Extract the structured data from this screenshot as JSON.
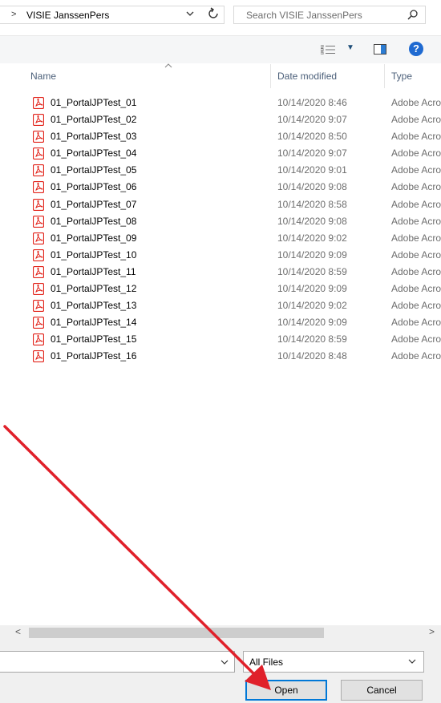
{
  "address_bar": {
    "chevron": ">",
    "path": "VISIE JanssenPers",
    "dropdown_icon": "chevron-down-icon",
    "refresh_icon": "refresh-icon"
  },
  "search": {
    "placeholder": "Search VISIE JanssenPers",
    "icon": "search-icon"
  },
  "toolbar": {
    "view_icon": "view-options-icon",
    "preview_pane_icon": "preview-pane-icon",
    "help_label": "?"
  },
  "columns": {
    "name": "Name",
    "date_modified": "Date modified",
    "type": "Type"
  },
  "files": [
    {
      "name": "01_PortalJPTest_01",
      "date": "10/14/2020 8:46",
      "type": "Adobe Acrobat Document"
    },
    {
      "name": "01_PortalJPTest_02",
      "date": "10/14/2020 9:07",
      "type": "Adobe Acrobat Document"
    },
    {
      "name": "01_PortalJPTest_03",
      "date": "10/14/2020 8:50",
      "type": "Adobe Acrobat Document"
    },
    {
      "name": "01_PortalJPTest_04",
      "date": "10/14/2020 9:07",
      "type": "Adobe Acrobat Document"
    },
    {
      "name": "01_PortalJPTest_05",
      "date": "10/14/2020 9:01",
      "type": "Adobe Acrobat Document"
    },
    {
      "name": "01_PortalJPTest_06",
      "date": "10/14/2020 9:08",
      "type": "Adobe Acrobat Document"
    },
    {
      "name": "01_PortalJPTest_07",
      "date": "10/14/2020 8:58",
      "type": "Adobe Acrobat Document"
    },
    {
      "name": "01_PortalJPTest_08",
      "date": "10/14/2020 9:08",
      "type": "Adobe Acrobat Document"
    },
    {
      "name": "01_PortalJPTest_09",
      "date": "10/14/2020 9:02",
      "type": "Adobe Acrobat Document"
    },
    {
      "name": "01_PortalJPTest_10",
      "date": "10/14/2020 9:09",
      "type": "Adobe Acrobat Document"
    },
    {
      "name": "01_PortalJPTest_11",
      "date": "10/14/2020 8:59",
      "type": "Adobe Acrobat Document"
    },
    {
      "name": "01_PortalJPTest_12",
      "date": "10/14/2020 9:09",
      "type": "Adobe Acrobat Document"
    },
    {
      "name": "01_PortalJPTest_13",
      "date": "10/14/2020 9:02",
      "type": "Adobe Acrobat Document"
    },
    {
      "name": "01_PortalJPTest_14",
      "date": "10/14/2020 9:09",
      "type": "Adobe Acrobat Document"
    },
    {
      "name": "01_PortalJPTest_15",
      "date": "10/14/2020 8:59",
      "type": "Adobe Acrobat Document"
    },
    {
      "name": "01_PortalJPTest_16",
      "date": "10/14/2020 8:48",
      "type": "Adobe Acrobat Document"
    }
  ],
  "file_name_input": {
    "value": ""
  },
  "file_type_select": {
    "selected": "All Files"
  },
  "buttons": {
    "open": "Open",
    "cancel": "Cancel"
  },
  "colors": {
    "accent_blue": "#0078d7",
    "pdf_red": "#e2231a",
    "annotation_arrow": "#e0202a",
    "help_blue": "#1f6ad1"
  }
}
